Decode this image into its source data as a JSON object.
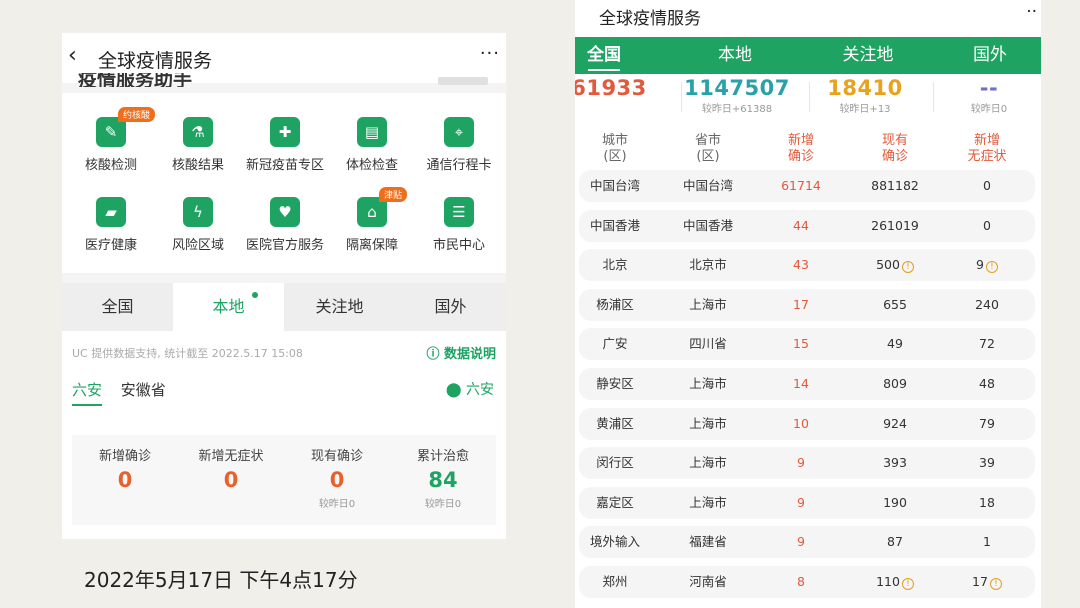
{
  "left": {
    "back_glyph": "‹",
    "title": "全球疫情服务",
    "more_glyph": "···",
    "helper_title": "疫情服务助手",
    "services": [
      {
        "label": "核酸检测",
        "icon": "test-tube-icon",
        "badge": "约核酸"
      },
      {
        "label": "核酸结果",
        "icon": "flask-icon",
        "badge": ""
      },
      {
        "label": "新冠疫苗专区",
        "icon": "vaccine-doc-icon",
        "badge": ""
      },
      {
        "label": "体检检查",
        "icon": "chart-doc-icon",
        "badge": ""
      },
      {
        "label": "通信行程卡",
        "icon": "travel-card-icon",
        "badge": ""
      },
      {
        "label": "医疗健康",
        "icon": "medical-folder-icon",
        "badge": ""
      },
      {
        "label": "风险区域",
        "icon": "lightning-icon",
        "badge": ""
      },
      {
        "label": "医院官方服务",
        "icon": "hospital-heart-icon",
        "badge": ""
      },
      {
        "label": "隔离保障",
        "icon": "house-heart-icon",
        "badge": "津贴"
      },
      {
        "label": "市民中心",
        "icon": "citizen-card-icon",
        "badge": ""
      }
    ],
    "tabs": [
      "全国",
      "本地",
      "关注地",
      "国外"
    ],
    "source_text": "UC 提供数据支持, 统计截至 2022.5.17 15:08",
    "explain_label": "数据说明",
    "region_city": "六安",
    "region_province": "安徽省",
    "location_label": "六安",
    "stats": [
      {
        "key": "新增确诊",
        "value": "0",
        "delta": "",
        "color": "#e8612c"
      },
      {
        "key": "新增无症状",
        "value": "0",
        "delta": "",
        "color": "#e8612c"
      },
      {
        "key": "现有确诊",
        "value": "0",
        "delta": "较昨日0",
        "color": "#e8612c"
      },
      {
        "key": "累计治愈",
        "value": "84",
        "delta": "较昨日0",
        "color": "#1ea362"
      }
    ]
  },
  "caption": "2022年5月17日 下午4点17分",
  "right": {
    "title": "全球疫情服务",
    "more_glyph": "··",
    "tabs": [
      "全国",
      "本地",
      "关注地",
      "国外"
    ],
    "stats": [
      {
        "value": "61933",
        "delta": "",
        "color": "#e25a3b"
      },
      {
        "value": "1147507",
        "delta": "较昨日+61388",
        "color": "#2aa1a8"
      },
      {
        "value": "18410",
        "delta": "较昨日+13",
        "color": "#e8a21c"
      },
      {
        "value": "--",
        "delta": "较昨日0",
        "color": "#6c6fcf"
      }
    ],
    "headers": [
      "城市\n(区)",
      "省市\n(区)",
      "新增\n确诊",
      "现有\n确诊",
      "新增\n无症状"
    ],
    "rows": [
      [
        "中国台湾",
        "中国台湾",
        "61714",
        "881182",
        "0"
      ],
      [
        "中国香港",
        "中国香港",
        "44",
        "261019",
        "0"
      ],
      [
        "北京",
        "北京市",
        "43",
        "500",
        "9"
      ],
      [
        "杨浦区",
        "上海市",
        "17",
        "655",
        "240"
      ],
      [
        "广安",
        "四川省",
        "15",
        "49",
        "72"
      ],
      [
        "静安区",
        "上海市",
        "14",
        "809",
        "48"
      ],
      [
        "黄浦区",
        "上海市",
        "10",
        "924",
        "79"
      ],
      [
        "闵行区",
        "上海市",
        "9",
        "393",
        "39"
      ],
      [
        "嘉定区",
        "上海市",
        "9",
        "190",
        "18"
      ],
      [
        "境外输入",
        "福建省",
        "9",
        "87",
        "1"
      ],
      [
        "郑州",
        "河南省",
        "8",
        "110",
        "17"
      ]
    ],
    "warn_rows": [
      2,
      10
    ],
    "warn_glyph": "!"
  }
}
